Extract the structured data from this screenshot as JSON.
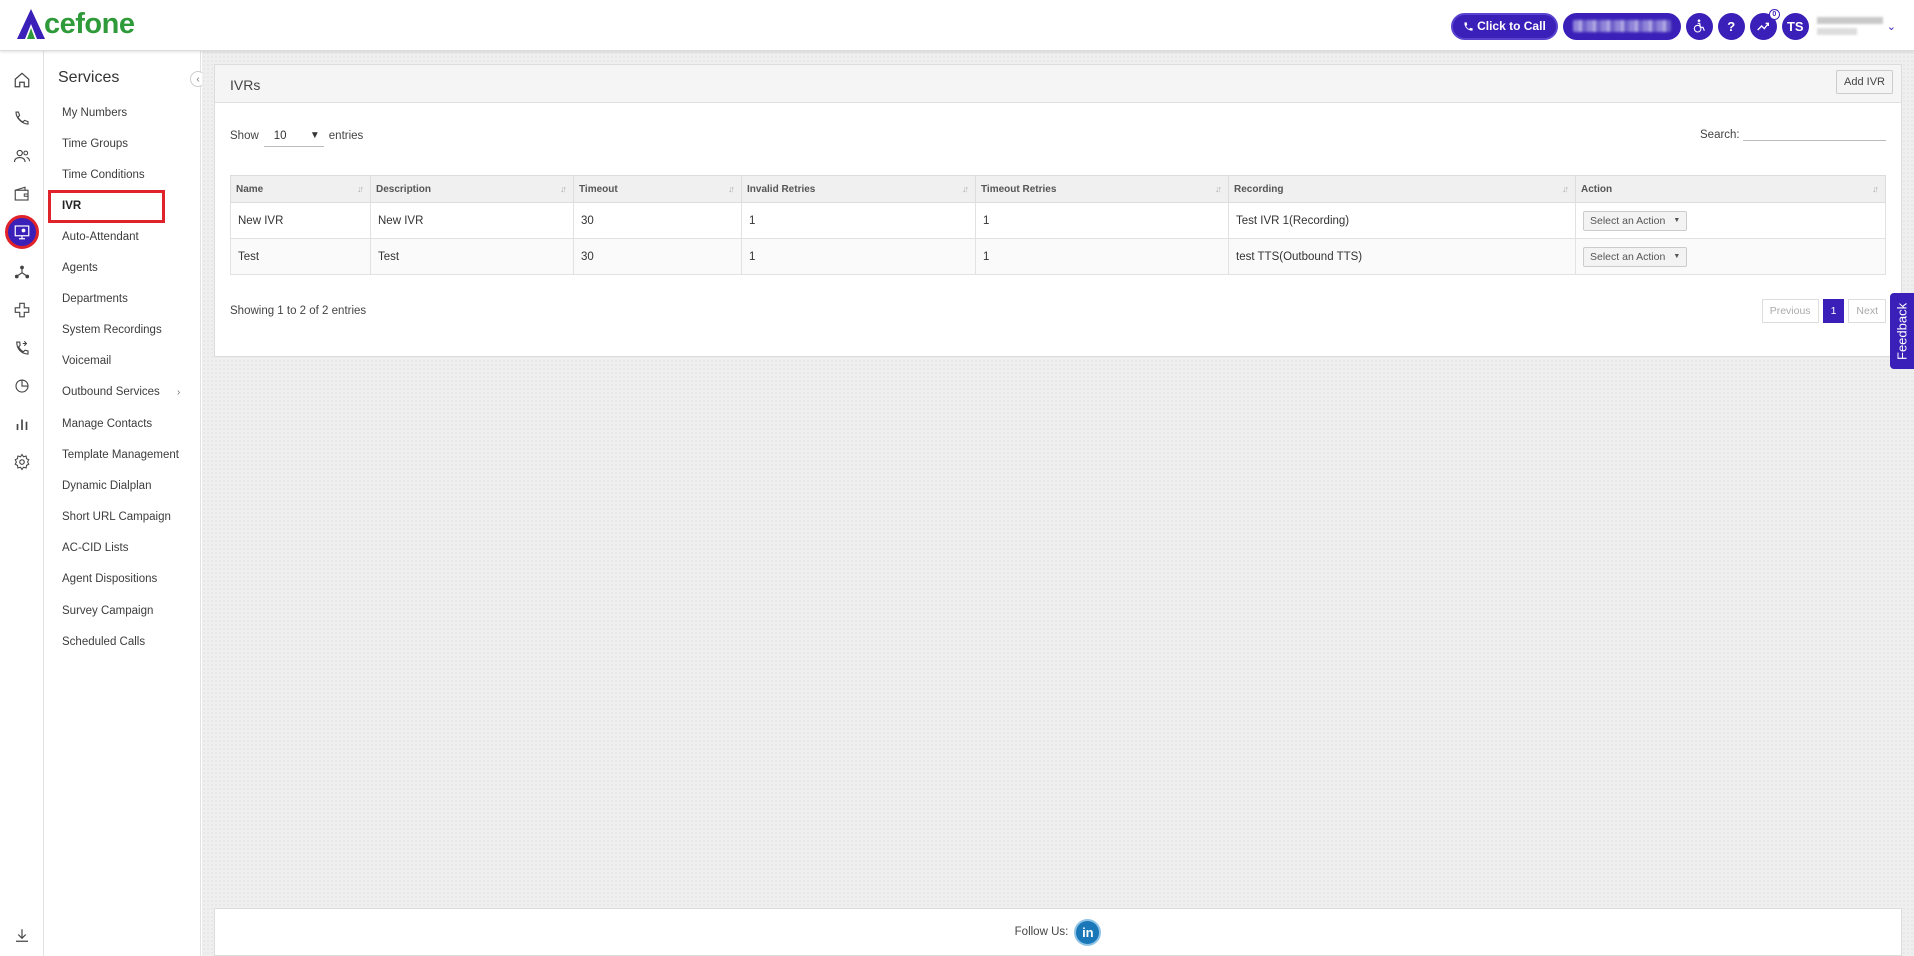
{
  "brand": {
    "logo_text": "cefone",
    "logo_alt": "Acefone",
    "accent": "#3a1fb8",
    "highlight": "#e0222a"
  },
  "topbar": {
    "click_to_call": "Click to Call",
    "help_label": "?",
    "initials": "TS",
    "notification_count": "0"
  },
  "rail": {
    "icons": [
      "home-icon",
      "phone-icon",
      "users-icon",
      "wallet-icon",
      "services-icon",
      "network-icon",
      "integration-icon",
      "call-routing-icon",
      "pie-chart-icon",
      "bar-chart-icon",
      "settings-icon",
      "download-icon"
    ]
  },
  "sidebar": {
    "title": "Services",
    "items": [
      {
        "label": "My Numbers"
      },
      {
        "label": "Time Groups"
      },
      {
        "label": "Time Conditions"
      },
      {
        "label": "IVR"
      },
      {
        "label": "Auto-Attendant"
      },
      {
        "label": "Agents"
      },
      {
        "label": "Departments"
      },
      {
        "label": "System Recordings"
      },
      {
        "label": "Voicemail"
      },
      {
        "label": "Outbound Services"
      },
      {
        "label": "Manage Contacts"
      },
      {
        "label": "Template Management"
      },
      {
        "label": "Dynamic Dialplan"
      },
      {
        "label": "Short URL Campaign"
      },
      {
        "label": "AC-CID Lists"
      },
      {
        "label": "Agent Dispositions"
      },
      {
        "label": "Survey Campaign"
      },
      {
        "label": "Scheduled Calls"
      }
    ]
  },
  "panel": {
    "title": "IVRs",
    "add_button": "Add IVR",
    "show_label": "Show",
    "entries_value": "10",
    "entries_label": "entries",
    "search_label": "Search:",
    "search_placeholder": "",
    "columns": [
      "Name",
      "Description",
      "Timeout",
      "Invalid Retries",
      "Timeout Retries",
      "Recording",
      "Action"
    ],
    "rows": [
      [
        "New IVR",
        "New IVR",
        "30",
        "1",
        "1",
        "Test IVR 1(Recording)",
        "Select an Action"
      ],
      [
        "Test",
        "Test",
        "30",
        "1",
        "1",
        "test TTS(Outbound TTS)",
        "Select an Action"
      ]
    ],
    "showing_text": "Showing 1 to 2 of 2 entries",
    "pager": {
      "previous": "Previous",
      "current": "1",
      "next": "Next"
    }
  },
  "feedback_label": "Feedback",
  "footer": {
    "follow_label": "Follow Us:",
    "linkedin": "in"
  }
}
